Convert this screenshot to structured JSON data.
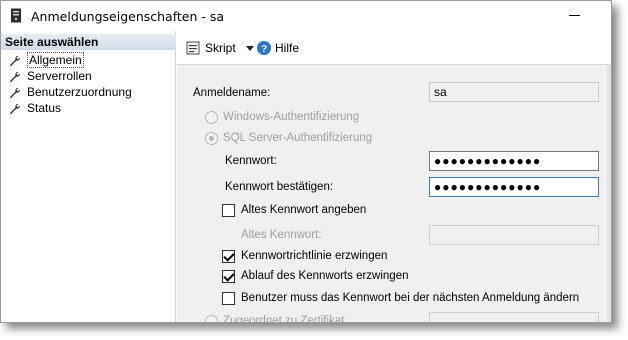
{
  "window": {
    "title": "Anmeldungseigenschaften - sa"
  },
  "sidebar": {
    "header": "Seite auswählen",
    "items": [
      {
        "label": "Allgemein",
        "selected": true
      },
      {
        "label": "Serverrollen"
      },
      {
        "label": "Benutzerzuordnung"
      },
      {
        "label": "Status"
      }
    ]
  },
  "toolbar": {
    "script_label": "Skript",
    "help_label": "Hilfe"
  },
  "form": {
    "login_name_label": "Anmeldename:",
    "login_name_value": "sa",
    "windows_auth_label": "Windows-Authentifizierung",
    "sql_auth_label": "SQL Server-Authentifizierung",
    "sql_auth_selected": true,
    "password_label": "Kennwort:",
    "password_value": "●●●●●●●●●●●●●",
    "confirm_password_label": "Kennwort bestätigen:",
    "confirm_password_value": "●●●●●●●●●●●●●",
    "old_password_checkbox_label": "Altes Kennwort angeben",
    "old_password_checked": false,
    "old_password_label": "Altes Kennwort:",
    "old_password_value": "",
    "enforce_policy_label": "Kennwortrichtlinie erzwingen",
    "enforce_policy_checked": true,
    "enforce_expiration_label": "Ablauf des Kennworts erzwingen",
    "enforce_expiration_checked": true,
    "must_change_label": "Benutzer muss das Kennwort bei der nächsten Anmeldung ändern",
    "must_change_checked": false,
    "certificate_label": "Zugeordnet zu Zertifikat"
  },
  "colors": {
    "accent": "#3c7fb1",
    "help": "#2a75c4",
    "disabled_text": "#a0a0a0"
  }
}
